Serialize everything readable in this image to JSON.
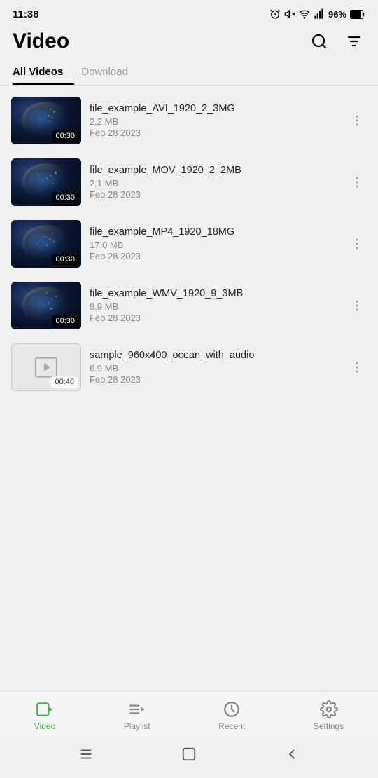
{
  "status": {
    "time": "11:38",
    "battery": "96%"
  },
  "header": {
    "title": "Video"
  },
  "tabs": [
    {
      "id": "all",
      "label": "All Videos",
      "active": true
    },
    {
      "id": "download",
      "label": "Download",
      "active": false
    }
  ],
  "videos": [
    {
      "id": 1,
      "name": "file_example_AVI_1920_2_3MG",
      "size": "2.2 MB",
      "date": "Feb 28 2023",
      "duration": "00:30",
      "thumb_type": "earth"
    },
    {
      "id": 2,
      "name": "file_example_MOV_1920_2_2MB",
      "size": "2.1 MB",
      "date": "Feb 28 2023",
      "duration": "00:30",
      "thumb_type": "earth"
    },
    {
      "id": 3,
      "name": "file_example_MP4_1920_18MG",
      "size": "17.0 MB",
      "date": "Feb 28 2023",
      "duration": "00:30",
      "thumb_type": "earth"
    },
    {
      "id": 4,
      "name": "file_example_WMV_1920_9_3MB",
      "size": "8.9 MB",
      "date": "Feb 28 2023",
      "duration": "00:30",
      "thumb_type": "earth"
    },
    {
      "id": 5,
      "name": "sample_960x400_ocean_with_audio",
      "size": "6.9 MB",
      "date": "Feb 28 2023",
      "duration": "00:46",
      "thumb_type": "placeholder"
    }
  ],
  "bottom_nav": [
    {
      "id": "video",
      "label": "Video",
      "active": true
    },
    {
      "id": "playlist",
      "label": "Playlist",
      "active": false
    },
    {
      "id": "recent",
      "label": "Recent",
      "active": false
    },
    {
      "id": "settings",
      "label": "Settings",
      "active": false
    }
  ],
  "colors": {
    "active_green": "#4caf50",
    "text_primary": "#000000",
    "text_secondary": "#888888",
    "bg": "#f0f0f0"
  }
}
